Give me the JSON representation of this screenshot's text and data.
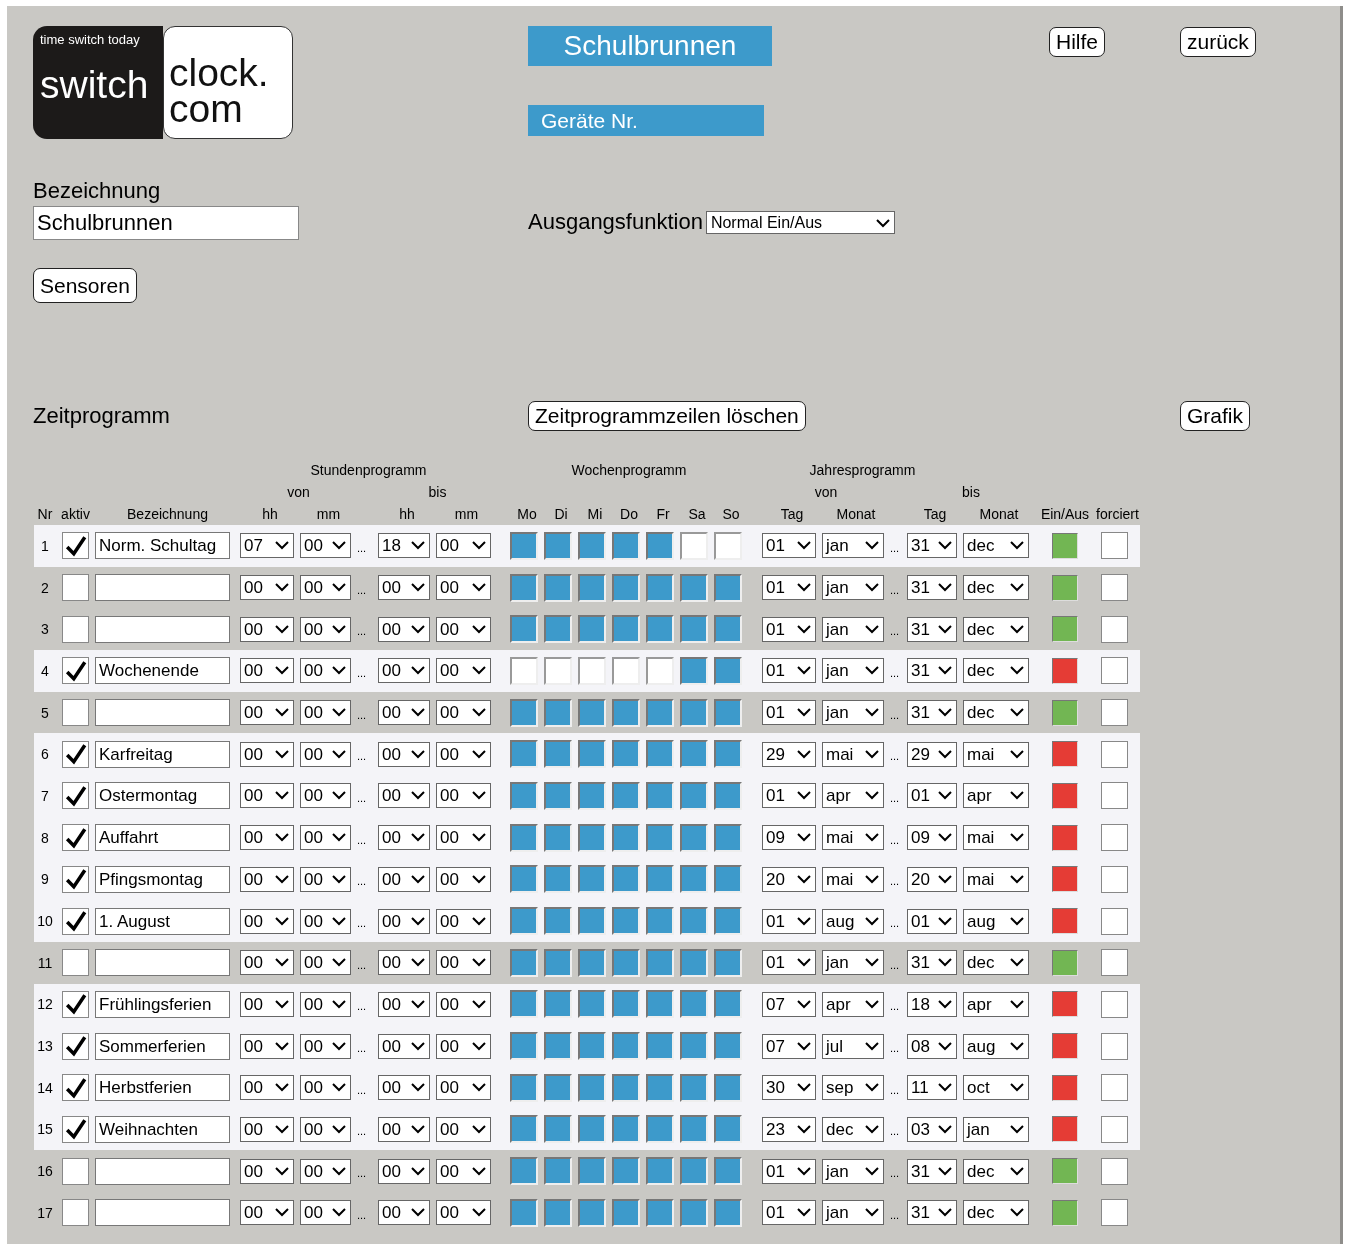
{
  "logo": {
    "tagline": "time switch today",
    "left": "switch",
    "right_top": "clock.",
    "right_bottom": "com"
  },
  "title": "Schulbrunnen",
  "device_label": "Geräte Nr.",
  "help_button": "Hilfe",
  "back_button": "zurück",
  "designation": {
    "label": "Bezeichnung",
    "value": "Schulbrunnen"
  },
  "output_function": {
    "label": "Ausgangsfunktion",
    "value": "Normal Ein/Aus"
  },
  "sensors_button": "Sensoren",
  "schedule": {
    "title": "Zeitprogramm",
    "clear_button": "Zeitprogrammzeilen löschen",
    "chart_button": "Grafik",
    "groups": [
      "Stundenprogramm",
      "Wochenprogramm",
      "Jahresprogramm"
    ],
    "subgroups": [
      "von",
      "bis",
      "von",
      "bis"
    ],
    "columns": [
      "Nr",
      "aktiv",
      "Bezeichnung",
      "hh",
      "mm",
      "hh",
      "mm",
      "Mo",
      "Di",
      "Mi",
      "Do",
      "Fr",
      "Sa",
      "So",
      "Tag",
      "Monat",
      "Tag",
      "Monat",
      "Ein/Aus",
      "forciert"
    ],
    "separator": "...",
    "rows": [
      {
        "nr": "1",
        "active": true,
        "name": "Norm. Schultag",
        "from": [
          "07",
          "00"
        ],
        "to": [
          "18",
          "00"
        ],
        "days": [
          true,
          true,
          true,
          true,
          true,
          false,
          false
        ],
        "date_from": [
          "01",
          "jan"
        ],
        "date_to": [
          "31",
          "dec"
        ],
        "on": true,
        "forced": false
      },
      {
        "nr": "2",
        "active": false,
        "from": [
          "00",
          "00"
        ],
        "to": [
          "00",
          "00"
        ],
        "days": [
          true,
          true,
          true,
          true,
          true,
          true,
          true
        ],
        "date_from": [
          "01",
          "jan"
        ],
        "date_to": [
          "31",
          "dec"
        ],
        "on": true,
        "forced": false
      },
      {
        "nr": "3",
        "active": false,
        "from": [
          "00",
          "00"
        ],
        "to": [
          "00",
          "00"
        ],
        "days": [
          true,
          true,
          true,
          true,
          true,
          true,
          true
        ],
        "date_from": [
          "01",
          "jan"
        ],
        "date_to": [
          "31",
          "dec"
        ],
        "on": true,
        "forced": false
      },
      {
        "nr": "4",
        "active": true,
        "name": "Wochenende",
        "from": [
          "00",
          "00"
        ],
        "to": [
          "00",
          "00"
        ],
        "days": [
          false,
          false,
          false,
          false,
          false,
          true,
          true
        ],
        "date_from": [
          "01",
          "jan"
        ],
        "date_to": [
          "31",
          "dec"
        ],
        "on": false,
        "forced": false
      },
      {
        "nr": "5",
        "active": false,
        "from": [
          "00",
          "00"
        ],
        "to": [
          "00",
          "00"
        ],
        "days": [
          true,
          true,
          true,
          true,
          true,
          true,
          true
        ],
        "date_from": [
          "01",
          "jan"
        ],
        "date_to": [
          "31",
          "dec"
        ],
        "on": true,
        "forced": false
      },
      {
        "nr": "6",
        "active": true,
        "name": "Karfreitag",
        "from": [
          "00",
          "00"
        ],
        "to": [
          "00",
          "00"
        ],
        "days": [
          true,
          true,
          true,
          true,
          true,
          true,
          true
        ],
        "date_from": [
          "29",
          "mai"
        ],
        "date_to": [
          "29",
          "mai"
        ],
        "on": false,
        "forced": false
      },
      {
        "nr": "7",
        "active": true,
        "name": "Ostermontag",
        "from": [
          "00",
          "00"
        ],
        "to": [
          "00",
          "00"
        ],
        "days": [
          true,
          true,
          true,
          true,
          true,
          true,
          true
        ],
        "date_from": [
          "01",
          "apr"
        ],
        "date_to": [
          "01",
          "apr"
        ],
        "on": false,
        "forced": false
      },
      {
        "nr": "8",
        "active": true,
        "name": "Auffahrt",
        "from": [
          "00",
          "00"
        ],
        "to": [
          "00",
          "00"
        ],
        "days": [
          true,
          true,
          true,
          true,
          true,
          true,
          true
        ],
        "date_from": [
          "09",
          "mai"
        ],
        "date_to": [
          "09",
          "mai"
        ],
        "on": false,
        "forced": false
      },
      {
        "nr": "9",
        "active": true,
        "name": "Pfingsmontag",
        "from": [
          "00",
          "00"
        ],
        "to": [
          "00",
          "00"
        ],
        "days": [
          true,
          true,
          true,
          true,
          true,
          true,
          true
        ],
        "date_from": [
          "20",
          "mai"
        ],
        "date_to": [
          "20",
          "mai"
        ],
        "on": false,
        "forced": false
      },
      {
        "nr": "10",
        "active": true,
        "name": "1. August",
        "from": [
          "00",
          "00"
        ],
        "to": [
          "00",
          "00"
        ],
        "days": [
          true,
          true,
          true,
          true,
          true,
          true,
          true
        ],
        "date_from": [
          "01",
          "aug"
        ],
        "date_to": [
          "01",
          "aug"
        ],
        "on": false,
        "forced": false
      },
      {
        "nr": "11",
        "active": false,
        "from": [
          "00",
          "00"
        ],
        "to": [
          "00",
          "00"
        ],
        "days": [
          true,
          true,
          true,
          true,
          true,
          true,
          true
        ],
        "date_from": [
          "01",
          "jan"
        ],
        "date_to": [
          "31",
          "dec"
        ],
        "on": true,
        "forced": false
      },
      {
        "nr": "12",
        "active": true,
        "name": "Frühlingsferien",
        "from": [
          "00",
          "00"
        ],
        "to": [
          "00",
          "00"
        ],
        "days": [
          true,
          true,
          true,
          true,
          true,
          true,
          true
        ],
        "date_from": [
          "07",
          "apr"
        ],
        "date_to": [
          "18",
          "apr"
        ],
        "on": false,
        "forced": false
      },
      {
        "nr": "13",
        "active": true,
        "name": "Sommerferien",
        "from": [
          "00",
          "00"
        ],
        "to": [
          "00",
          "00"
        ],
        "days": [
          true,
          true,
          true,
          true,
          true,
          true,
          true
        ],
        "date_from": [
          "07",
          "jul"
        ],
        "date_to": [
          "08",
          "aug"
        ],
        "on": false,
        "forced": false
      },
      {
        "nr": "14",
        "active": true,
        "name": "Herbstferien",
        "from": [
          "00",
          "00"
        ],
        "to": [
          "00",
          "00"
        ],
        "days": [
          true,
          true,
          true,
          true,
          true,
          true,
          true
        ],
        "date_from": [
          "30",
          "sep"
        ],
        "date_to": [
          "11",
          "oct"
        ],
        "on": false,
        "forced": false
      },
      {
        "nr": "15",
        "active": true,
        "name": "Weihnachten",
        "from": [
          "00",
          "00"
        ],
        "to": [
          "00",
          "00"
        ],
        "days": [
          true,
          true,
          true,
          true,
          true,
          true,
          true
        ],
        "date_from": [
          "23",
          "dec"
        ],
        "date_to": [
          "03",
          "jan"
        ],
        "on": false,
        "forced": false
      },
      {
        "nr": "16",
        "active": false,
        "from": [
          "00",
          "00"
        ],
        "to": [
          "00",
          "00"
        ],
        "days": [
          true,
          true,
          true,
          true,
          true,
          true,
          true
        ],
        "date_from": [
          "01",
          "jan"
        ],
        "date_to": [
          "31",
          "dec"
        ],
        "on": true,
        "forced": false
      },
      {
        "nr": "17",
        "active": false,
        "from": [
          "00",
          "00"
        ],
        "to": [
          "00",
          "00"
        ],
        "days": [
          true,
          true,
          true,
          true,
          true,
          true,
          true
        ],
        "date_from": [
          "01",
          "jan"
        ],
        "date_to": [
          "31",
          "dec"
        ],
        "on": true,
        "forced": false
      }
    ]
  }
}
